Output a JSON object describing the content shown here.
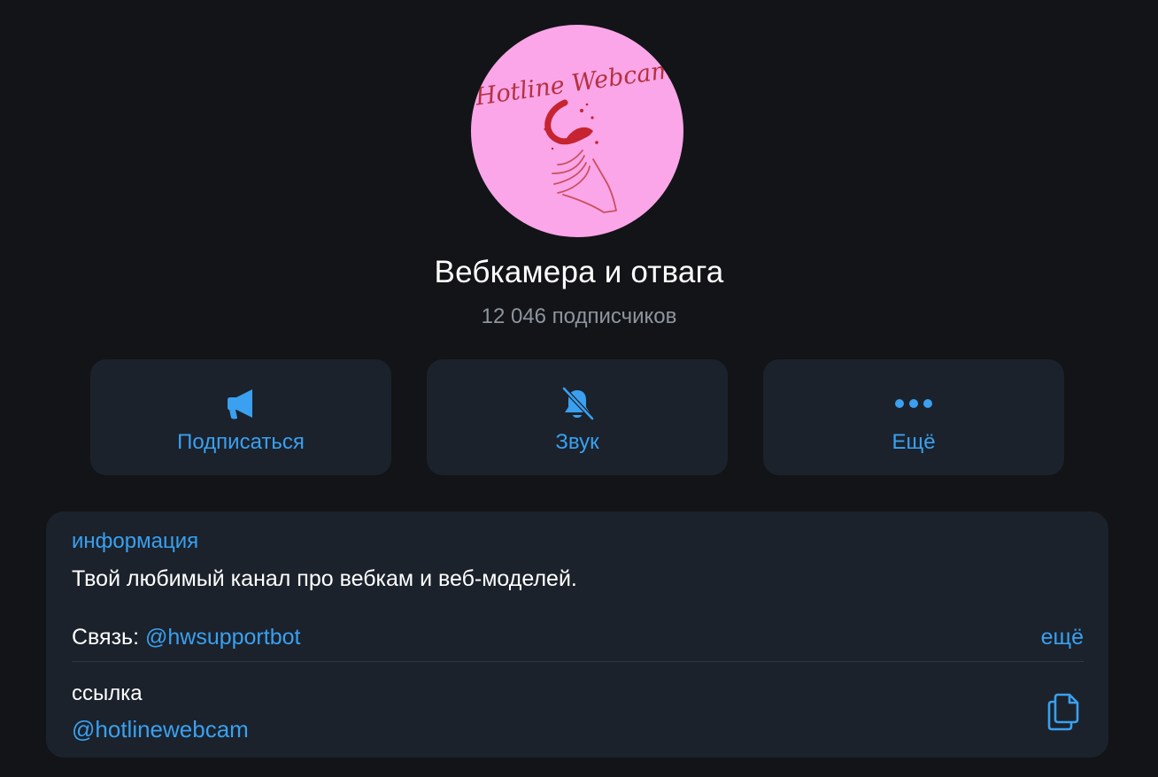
{
  "avatar": {
    "brand_text": "Hotline Webcam",
    "background_color": "#fba6e9"
  },
  "channel": {
    "title": "Вебкамера и отвага",
    "subscribers": "12 046 подписчиков"
  },
  "actions": [
    {
      "label": "Подписаться",
      "icon": "megaphone-icon"
    },
    {
      "label": "Звук",
      "icon": "bell-muted-icon"
    },
    {
      "label": "Ещё",
      "icon": "more-dots-icon"
    }
  ],
  "info": {
    "heading": "информация",
    "description": "Твой любимый канал про вебкам и веб-моделей.",
    "contact_prefix": "Связь: ",
    "contact_mention": "@hwsupportbot",
    "more_label": "ещё",
    "link_label": "ссылка",
    "link_value": "@hotlinewebcam",
    "copy_icon": "copy-icon"
  },
  "colors": {
    "background": "#131417",
    "card": "#1b222c",
    "accent": "#3aa0ef",
    "muted_text": "#8e959f"
  }
}
